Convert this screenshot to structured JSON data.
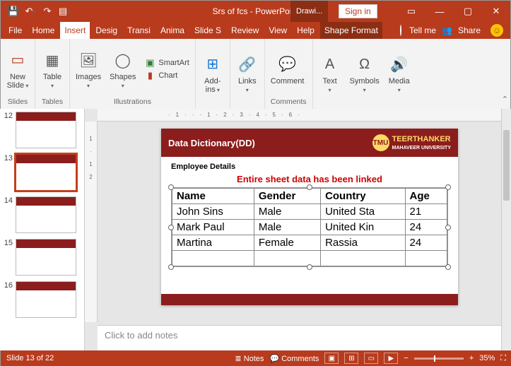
{
  "titlebar": {
    "title": "Srs of fcs  -  PowerPoint",
    "drawing_tab": "Drawi...",
    "signin": "Sign in"
  },
  "tabs": {
    "file": "File",
    "home": "Home",
    "insert": "Insert",
    "design": "Desig",
    "transitions": "Transi",
    "animations": "Anima",
    "slideshow": "Slide S",
    "review": "Review",
    "view": "View",
    "help": "Help",
    "shapeformat": "Shape Format",
    "tellme": "Tell me",
    "share": "Share"
  },
  "ribbon": {
    "slides_group": "Slides",
    "new_slide": "New\nSlide",
    "tables_group": "Tables",
    "table": "Table",
    "illustrations_group": "Illustrations",
    "images": "Images",
    "shapes": "Shapes",
    "smartart": "SmartArt",
    "chart": "Chart",
    "addins_group": "",
    "addins": "Add-\nins",
    "links_group": "",
    "links": "Links",
    "comments_group": "Comments",
    "comment": "Comment",
    "text_group": "",
    "text": "Text",
    "symbols": "Symbols",
    "media": "Media"
  },
  "thumbs": [
    "12",
    "13",
    "14",
    "15",
    "16"
  ],
  "slide": {
    "heading": "Data Dictionary(DD)",
    "brand1": "TEERTHANKER",
    "brand2": "MAHAVEER UNIVERSITY",
    "subtitle": "Employee Details",
    "message": "Entire sheet data has been linked",
    "headers": [
      "Name",
      "Gender",
      "Country",
      "Age"
    ],
    "rows": [
      [
        "John Sins",
        "Male",
        "United Sta",
        "21"
      ],
      [
        "Mark Paul",
        "Male",
        "United Kin",
        "24"
      ],
      [
        "Martina",
        "Female",
        "Rassia",
        "24"
      ]
    ]
  },
  "notes_placeholder": "Click to add notes",
  "status": {
    "slide": "Slide 13 of 22",
    "notes": "Notes",
    "comments": "Comments",
    "zoom": "35%"
  }
}
